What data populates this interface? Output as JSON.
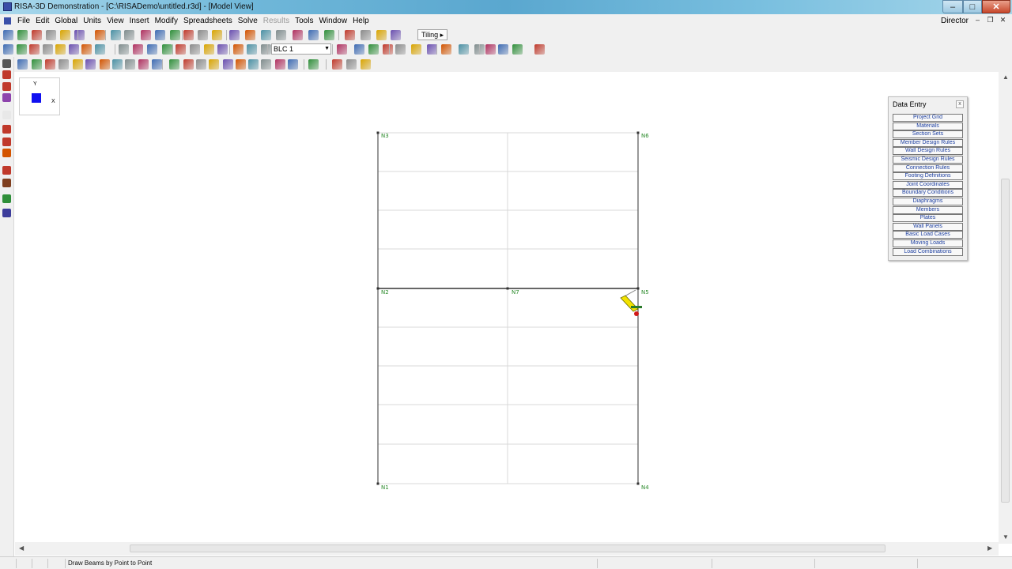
{
  "window": {
    "title": "RISA-3D Demonstration - [C:\\RISADemo\\untitled.r3d] - [Model View]",
    "min_glyph": "–",
    "max_glyph": "□",
    "close_glyph": "✕"
  },
  "menu": {
    "items": [
      "File",
      "Edit",
      "Global",
      "Units",
      "View",
      "Insert",
      "Modify",
      "Spreadsheets",
      "Solve",
      "Results",
      "Tools",
      "Window",
      "Help"
    ],
    "disabled": [
      "Results"
    ],
    "right_label": "Director"
  },
  "toolbar": {
    "tiling_label": "Tiling ▸",
    "load_case_value": "BLC 1"
  },
  "axis": {
    "y_label": "Y",
    "x_label": "X"
  },
  "nodes": [
    "N3",
    "N6",
    "N2",
    "N7",
    "N5",
    "N1",
    "N4"
  ],
  "data_entry": {
    "title": "Data Entry",
    "close_glyph": "x",
    "buttons": [
      "Project Grid",
      "Materials",
      "Section Sets",
      "Member Design Rules",
      "Wall Design Rules",
      "Seismic Design Rules",
      "Connection Rules",
      "Footing Definitions",
      "Joint Coordinates",
      "Boundary Conditions",
      "Diaphragms",
      "Members",
      "Plates",
      "Wall Panels",
      "Basic Load Cases",
      "Moving Loads",
      "Load Combinations"
    ]
  },
  "status": {
    "message": "Draw Beams by Point to Point"
  },
  "colors": {
    "node_label": "#2a8a2a",
    "member_line": "#555555",
    "grid_line": "#d9d9d9",
    "accent": "#1d3fa0"
  }
}
